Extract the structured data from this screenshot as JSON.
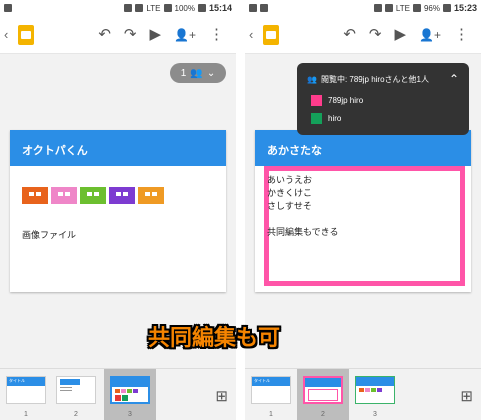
{
  "left": {
    "status": {
      "network": "LTE",
      "battery": "100%",
      "time": "15:14"
    },
    "collab_pill": {
      "count": "1",
      "icon": "people-icon"
    },
    "slide": {
      "title": "オクトパくん",
      "tile_colors": [
        "#e8631c",
        "#ef86c8",
        "#6cbf2f",
        "#7d3bd1",
        "#ef9a24"
      ],
      "caption": "画像ファイル"
    },
    "thumbs": [
      {
        "number": "1",
        "label": "タイトル"
      },
      {
        "number": "2",
        "label": ""
      },
      {
        "number": "3",
        "label": ""
      }
    ],
    "selected_thumb": "3"
  },
  "right": {
    "status": {
      "network": "LTE",
      "battery": "96%",
      "time": "15:23"
    },
    "collab_panel": {
      "header": "閲覧中: 789jp hiroさんと他1人",
      "users": [
        {
          "name": "789jp hiro",
          "color": "#ff3c8c"
        },
        {
          "name": "hiro",
          "color": "#14a05a"
        }
      ]
    },
    "slide": {
      "title": "あかさたな",
      "lines": [
        "あいうえお",
        "かきくけこ",
        "さしすせそ",
        "",
        "共同編集もできる"
      ]
    },
    "thumbs": [
      {
        "number": "1",
        "label": "タイトル"
      },
      {
        "number": "2",
        "label": ""
      },
      {
        "number": "3",
        "label": ""
      }
    ],
    "selected_thumb": "2"
  },
  "overlay_caption": "共同編集も可",
  "icons": {
    "back": "‹",
    "undo": "↶",
    "redo": "↷",
    "play": "▶",
    "add_person": "👤+",
    "more": "⋮",
    "add_slide": "⊞"
  }
}
